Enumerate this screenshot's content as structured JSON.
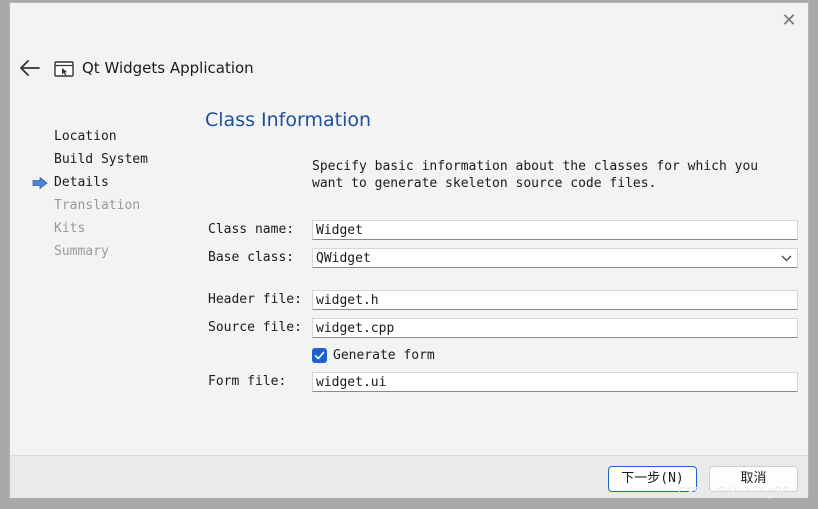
{
  "window": {
    "title": "Qt Widgets Application",
    "close_glyph": "✕",
    "icons": {
      "back": "back-arrow-icon",
      "app": "qt-widgets-app-icon",
      "close": "close-icon"
    }
  },
  "steps": [
    {
      "label": "Location",
      "state": "done"
    },
    {
      "label": "Build System",
      "state": "done"
    },
    {
      "label": "Details",
      "state": "current"
    },
    {
      "label": "Translation",
      "state": "pending"
    },
    {
      "label": "Kits",
      "state": "pending"
    },
    {
      "label": "Summary",
      "state": "pending"
    }
  ],
  "page": {
    "title": "Class Information",
    "description_line1": "Specify basic information about the classes for which you",
    "description_line2": "want to generate skeleton source code files."
  },
  "form": {
    "class_name_label": "Class name:",
    "class_name_value": "Widget",
    "base_class_label": "Base class:",
    "base_class_value": "QWidget",
    "header_file_label": "Header file:",
    "header_file_value": "widget.h",
    "source_file_label": "Source file:",
    "source_file_value": "widget.cpp",
    "generate_form_label": "Generate form",
    "generate_form_checked": true,
    "form_file_label": "Form file:",
    "form_file_value": "widget.ui"
  },
  "footer": {
    "next_label": "下一步(N)",
    "cancel_label": "取消"
  },
  "watermark": "CSDN @HuoJing96",
  "colors": {
    "accent": "#1f63c8",
    "title_blue": "#1f4f9c",
    "current_step_arrow": "#4a86d4",
    "disabled_text": "#9a9a9a"
  }
}
